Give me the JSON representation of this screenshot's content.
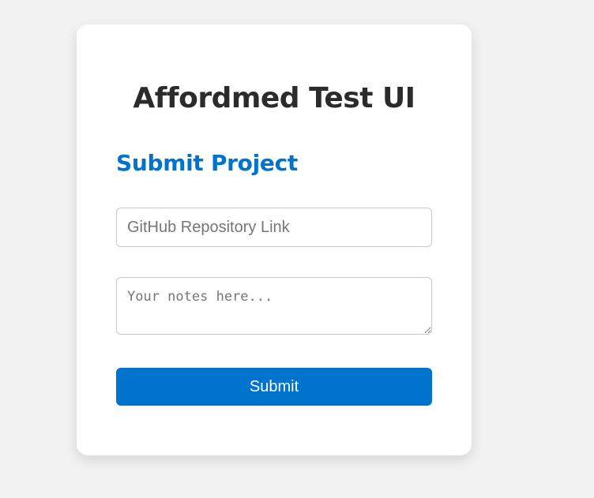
{
  "header": {
    "title": "Affordmed Test UI"
  },
  "form": {
    "heading": "Submit Project",
    "repo_input": {
      "placeholder": "GitHub Repository Link",
      "value": ""
    },
    "notes": {
      "placeholder": "Your notes here...",
      "value": ""
    },
    "submit_label": "Submit"
  },
  "colors": {
    "accent": "#0074cc",
    "background": "#f2f2f2",
    "card": "#ffffff",
    "title_text": "#2b2b2b"
  }
}
